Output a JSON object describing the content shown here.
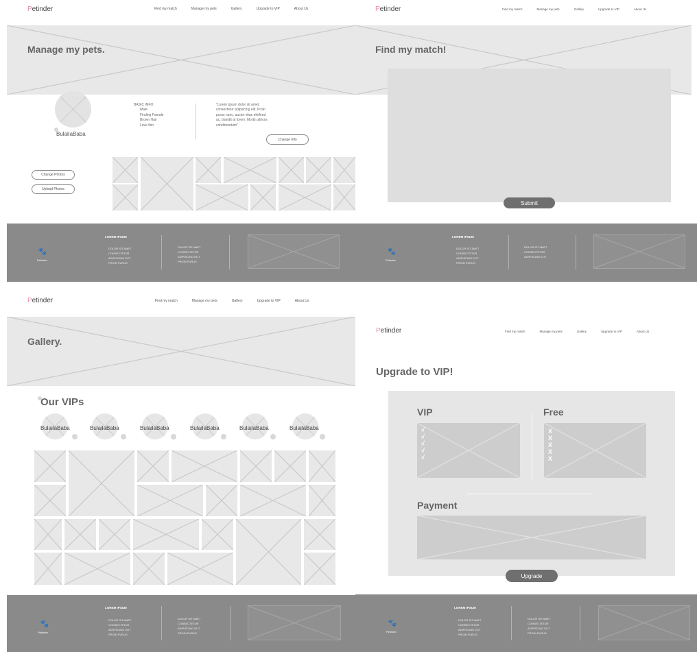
{
  "brand": {
    "name": "Petinder",
    "first_letter": "P",
    "rest": "etinder"
  },
  "nav": [
    "Find my match",
    "Manage my pets",
    "Gallery",
    "Upgrade to VIP",
    "About Us"
  ],
  "manage": {
    "title": "Manage my pets.",
    "pet_name": "BulailaBaba",
    "basic_info_heading": "BASIC INFO",
    "basic_info": [
      "Male",
      "Finding Famale",
      "Brown Hair",
      "Love fish"
    ],
    "quote_lines": [
      "\"Lorem ipsum dolor sit amet,",
      "consectetur adipiscing elit. Proin",
      "purus nunc, auctor vitae eleifend",
      "ac, blandit at lorem. Morbi ultrices",
      "condimentum\""
    ],
    "change_info_label": "Change Info",
    "change_photos_label": "Change Photos",
    "upload_photos_label": "Upload Photos"
  },
  "match": {
    "title": "Find my match!",
    "submit_label": "Submit"
  },
  "gallery": {
    "title": "Gallery.",
    "vips_heading": "Our VIPs",
    "vip_names": [
      "BulailaBaba",
      "BulailaBaba",
      "BulailaBaba",
      "BulailaBaba",
      "BulailaBaba",
      "BulailaBaba"
    ]
  },
  "upgrade": {
    "title": "Upgrade to VIP!",
    "vip_label": "VIP",
    "free_label": "Free",
    "check_mark": "√",
    "cross_mark": "X",
    "payment_label": "Payment",
    "upgrade_label": "Upgrade"
  },
  "footer": {
    "brand": "Petinder",
    "heading": "LOREM IPSUM",
    "col1": [
      "DOLOR SIT AMET",
      "CONSECTETUR",
      "ADIPISCING ELIT",
      "PROIN PURUS"
    ],
    "col2": [
      "DOLOR SIT AMET",
      "CONSECTETUR",
      "ADIPISCING ELIT",
      "PROIN PURUS"
    ]
  },
  "colors": {
    "accent_pink": "#e48aa6",
    "footer_gray": "#8a8a8a",
    "button_dark": "#6f6f6f"
  }
}
